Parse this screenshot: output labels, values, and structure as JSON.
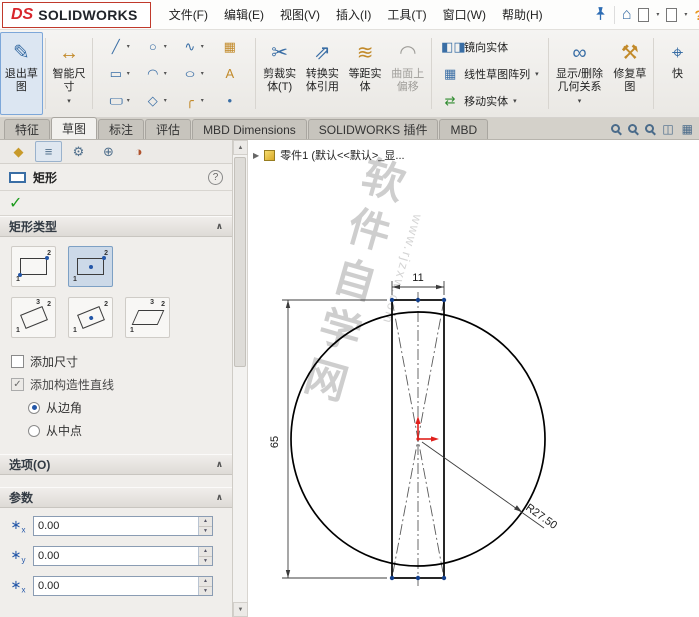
{
  "titlebar": {
    "logo_ds": "DS",
    "logo_brand": "SOLIDWORKS",
    "menus": [
      "文件(F)",
      "编辑(E)",
      "视图(V)",
      "插入(I)",
      "工具(T)",
      "窗口(W)",
      "帮助(H)"
    ]
  },
  "icons": {
    "home": "⌂",
    "dropdown": "▼",
    "caret": "▾",
    "collapse": "∧",
    "help": "?",
    "check": "✓",
    "tree_expand": "▶",
    "spin_up": "▲",
    "spin_down": "▼",
    "exit_sketch": "✎",
    "smart_dimension": "↔",
    "line": "╱",
    "circle": "○",
    "spline": "∿",
    "pattern": "▦",
    "rectangle": "▭",
    "arc": "◠",
    "ellipse": "○",
    "text_tool": "A",
    "slot": "▢",
    "polygon": "◇",
    "fillet": "╭",
    "point": "•",
    "trim": "✂",
    "convert": "⇗",
    "offset": "≋",
    "surface_offset": "◠",
    "mirror": "◧◨",
    "linear_pattern": "▦",
    "move": "⇄",
    "relations": "∞",
    "repair": "⚒",
    "quick_snap": "⌖",
    "section_view": "◫",
    "display_style": "▦",
    "tab_part": "◆",
    "tab_props": "≡",
    "tab_config": "⚙",
    "tab_dimxpert": "⊕",
    "tab_display": "◑",
    "param_star": "∗",
    "num1": "1",
    "num2": "2",
    "num3": "3"
  },
  "ribbon": {
    "exit_sketch": "退出草图",
    "smart_dimension": "智能尺寸",
    "trim_entities": "剪裁实体(T)",
    "convert_entities": "转换实体引用",
    "offset_entities": "等距实体",
    "surface_offset": "曲面上偏移",
    "mirror_entities": "镜向实体",
    "linear_sketch_pattern": "线性草图阵列",
    "move_entities": "移动实体",
    "display_delete_relations": "显示/删除几何关系",
    "repair_sketch": "修复草图",
    "quick_snaps": "快"
  },
  "command_tabs": {
    "tabs": [
      "特征",
      "草图",
      "标注",
      "评估",
      "MBD Dimensions",
      "SOLIDWORKS 插件",
      "MBD"
    ],
    "active": "草图"
  },
  "property_panel": {
    "title": "矩形",
    "sections": {
      "rect_type": "矩形类型",
      "options": "选项(O)",
      "parameters": "参数"
    },
    "add_dimensions_label": "添加尺寸",
    "add_construction_label": "添加构造性直线",
    "from_corner_label": "从边角",
    "from_midpoint_label": "从中点",
    "params": [
      {
        "axis": "x",
        "value": "0.00"
      },
      {
        "axis": "y",
        "value": "0.00"
      },
      {
        "axis": "x",
        "value": "0.00"
      }
    ]
  },
  "feature_tree": {
    "root_label": "零件1 (默认<<默认>_显..."
  },
  "sketch": {
    "dim_width": "11",
    "dim_height": "65",
    "dim_radius": "R27.50",
    "watermark_text": "软件自学网",
    "watermark_url": "www.rjzxw.com"
  },
  "colors": {
    "accent_red": "#d8262c",
    "selection_blue": "#2e6db4",
    "origin_red": "#e0201c"
  }
}
